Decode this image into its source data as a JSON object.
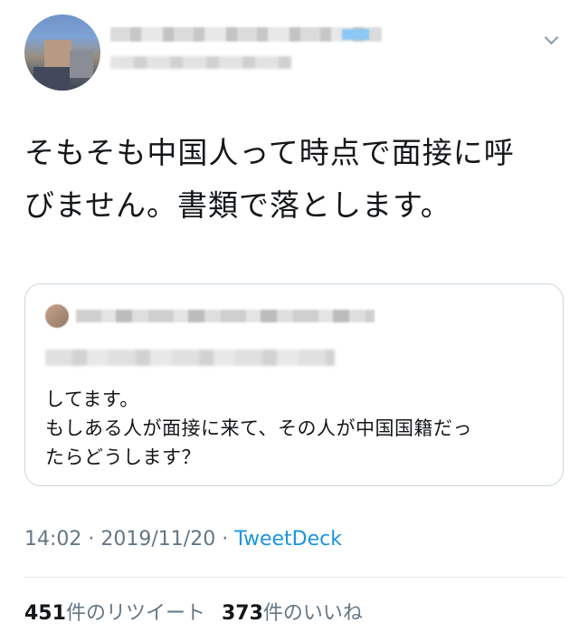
{
  "tweet": {
    "text_line1": "そもそも中国人って時点で面接に呼",
    "text_line2": "びません。書類で落とします。"
  },
  "quoted_tweet": {
    "text_line1": "してます。",
    "text_line2": "もしある人が面接に来て、その人が中国国籍だっ",
    "text_line3": "たらどうします？"
  },
  "meta": {
    "time": "14:02",
    "separator": " · ",
    "date": "2019/11/20",
    "source": "TweetDeck"
  },
  "stats": {
    "retweets_count": "451",
    "retweets_label": "件のリツイート",
    "likes_count": "373",
    "likes_label": "件のいいね"
  },
  "icons": {
    "menu": "chevron-down-icon"
  }
}
